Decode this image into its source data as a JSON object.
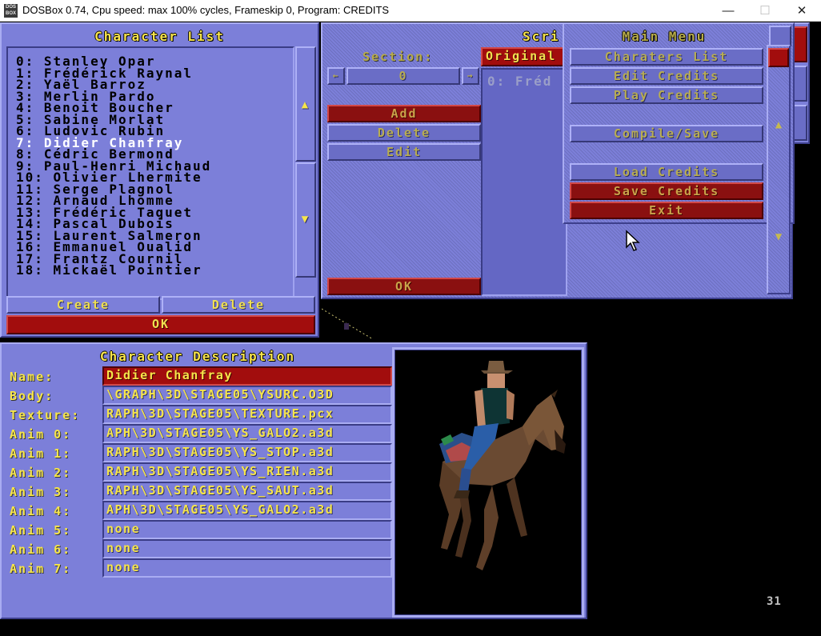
{
  "window": {
    "icon_text": "DOS BOX",
    "title": "DOSBox 0.74, Cpu speed: max 100% cycles, Frameskip  0, Program:  CREDITS",
    "minimize": "—",
    "maximize": "☐",
    "close": "✕"
  },
  "char_list": {
    "title": "Character List",
    "items": [
      "0: Stanley Opar",
      "1: Frédérick Raynal",
      "2: Yaël Barroz",
      "3: Merlin Pardo",
      "4: Benoit Boucher",
      "5: Sabine Morlat",
      "6: Ludovic Rubin",
      "7: Didier Chanfray",
      "8: Cédric Bermond",
      "9: Paul-Henri Michaud",
      "10: Olivier Lhermite",
      "11: Serge Plagnol",
      "12: Arnaud Lhomme",
      "13: Frédéric Taquet",
      "14: Pascal Dubois",
      "15: Laurent Salmeron",
      "16: Emmanuel Oualid",
      "17: Frantz Cournil",
      "18: Mickaël Pointier"
    ],
    "selected_index": 7,
    "create": "Create",
    "delete": "Delete",
    "ok": "OK",
    "scroll_up": "▲",
    "scroll_down": "▼"
  },
  "script_panel": {
    "title": "Scri",
    "section_label": "Section:",
    "section_value": "0",
    "dec": "←",
    "inc": "→",
    "original_tab": "Original",
    "list_item": "0: Fréd",
    "add": "Add",
    "delete": "Delete",
    "edit": "Edit",
    "ok": "OK"
  },
  "main_menu": {
    "title": "Main Menu",
    "items": [
      {
        "label": "Charaters List"
      },
      {
        "label": "Edit Credits"
      },
      {
        "label": "Play Credits"
      },
      {
        "label": "Compile/Save"
      },
      {
        "label": "Load Credits"
      },
      {
        "label": "Save Credits"
      },
      {
        "label": "Exit"
      }
    ],
    "scroll_up": "▲",
    "scroll_down": "▼"
  },
  "char_desc": {
    "title": "Character Description",
    "fields": [
      {
        "label": "Name:",
        "value": "Didier Chanfray"
      },
      {
        "label": "Body:",
        "value": "\\GRAPH\\3D\\STAGE05\\YSURC.O3D"
      },
      {
        "label": "Texture:",
        "value": "RAPH\\3D\\STAGE05\\TEXTURE.pcx"
      },
      {
        "label": "Anim 0:",
        "value": "APH\\3D\\STAGE05\\YS_GALO2.a3d"
      },
      {
        "label": "Anim 1:",
        "value": "RAPH\\3D\\STAGE05\\YS_STOP.a3d"
      },
      {
        "label": "Anim 2:",
        "value": "RAPH\\3D\\STAGE05\\YS_RIEN.a3d"
      },
      {
        "label": "Anim 3:",
        "value": "RAPH\\3D\\STAGE05\\YS_SAUT.a3d"
      },
      {
        "label": "Anim 4:",
        "value": "APH\\3D\\STAGE05\\YS_GALO2.a3d"
      },
      {
        "label": "Anim 5:",
        "value": "none"
      },
      {
        "label": "Anim 6:",
        "value": "none"
      },
      {
        "label": "Anim 7:",
        "value": "none"
      }
    ]
  },
  "fps_counter": "31",
  "colors": {
    "panel": "#7c7fd9",
    "label_yellow": "#f6e54a",
    "button_red": "#a20d0d"
  }
}
